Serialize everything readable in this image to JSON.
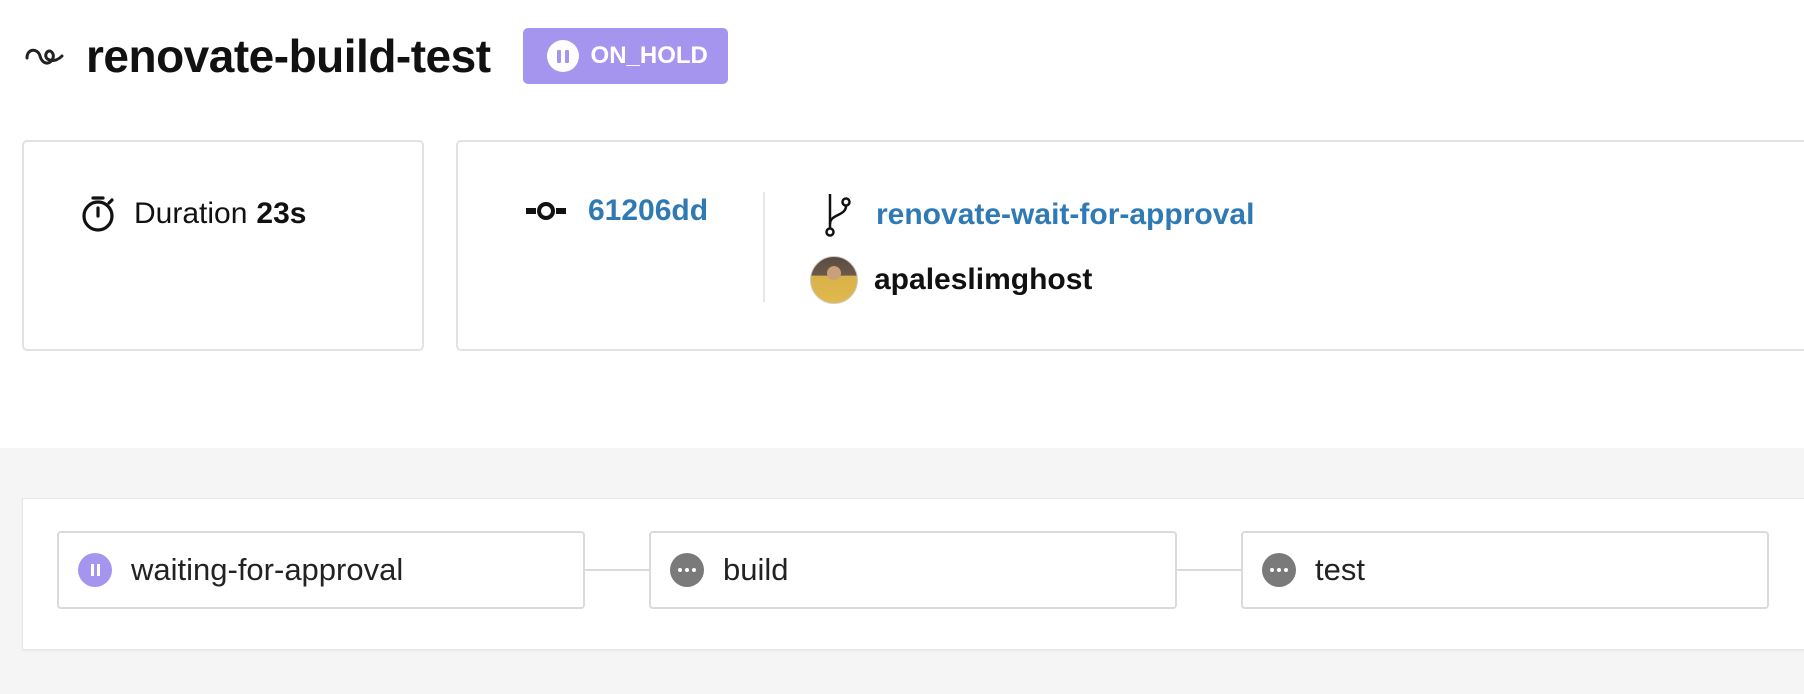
{
  "header": {
    "icon": "workflow-icon",
    "title": "renovate-build-test",
    "status": {
      "label": "ON_HOLD",
      "icon": "pause-icon",
      "color": "#a695ef"
    }
  },
  "duration_card": {
    "icon": "stopwatch-icon",
    "label": "Duration",
    "value": "23s"
  },
  "commit_card": {
    "commit_icon": "commit-icon",
    "commit_sha": "61206dd",
    "branch_icon": "git-branch-icon",
    "branch": "renovate-wait-for-approval",
    "author": "apaleslimghost",
    "link_color": "#2f7ab4"
  },
  "pipeline": {
    "steps": [
      {
        "name": "waiting-for-approval",
        "status": "on_hold",
        "icon": "pause-icon"
      },
      {
        "name": "build",
        "status": "pending",
        "icon": "more-dots-icon"
      },
      {
        "name": "test",
        "status": "pending",
        "icon": "more-dots-icon"
      }
    ]
  }
}
